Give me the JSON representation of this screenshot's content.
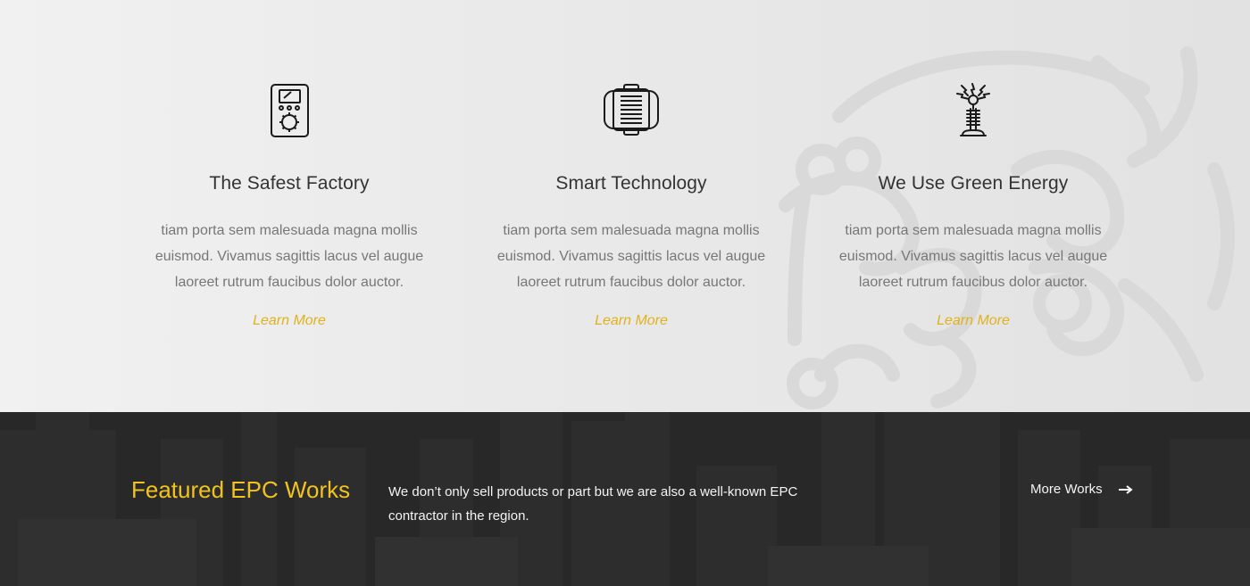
{
  "features": {
    "cards": [
      {
        "icon": "multimeter-icon",
        "title": "The Safest Factory",
        "text": "tiam porta sem malesuada magna mollis euismod. Vivamus sagittis lacus vel augue laoreet rutrum faucibus dolor auctor.",
        "link": "Learn More"
      },
      {
        "icon": "generator-icon",
        "title": "Smart Technology",
        "text": "tiam porta sem malesuada magna mollis euismod. Vivamus sagittis lacus vel augue laoreet rutrum faucibus dolor auctor.",
        "link": "Learn More"
      },
      {
        "icon": "tesla-coil-icon",
        "title": "We Use Green Energy",
        "text": "tiam porta sem malesuada magna mollis euismod. Vivamus sagittis lacus vel augue laoreet rutrum faucibus dolor auctor.",
        "link": "Learn More"
      }
    ]
  },
  "featured": {
    "title": "Featured EPC Works",
    "description": "We don’t only sell products or part but we are also a well-known EPC contractor in the region.",
    "more_label": "More Works",
    "more_icon": "arrow-right-icon"
  },
  "colors": {
    "accent": "#f2c21e",
    "link": "#e0b21c",
    "dark_band": "#2c2c2c"
  }
}
